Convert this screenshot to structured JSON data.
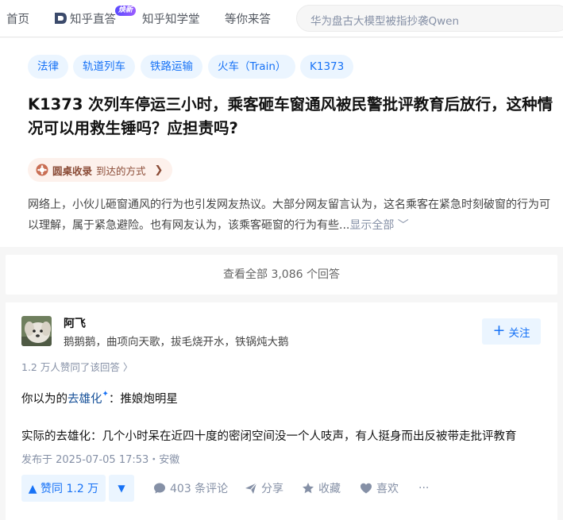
{
  "nav": {
    "home": "首页",
    "zhida": "知乎直答",
    "zhida_badge": "焕新",
    "zhixuetang": "知乎知学堂",
    "waiting": "等你来答",
    "search_placeholder": "华为盘古大模型被指抄袭Qwen"
  },
  "question": {
    "tags": [
      "法律",
      "轨道列车",
      "铁路运输",
      "火车（Train）",
      "K1373"
    ],
    "title": "K1373 次列车停运三小时，乘客砸车窗通风被民警批评教育后放行，这种情况可以用救生锤吗？应担责吗?",
    "roundtable_label": "圆桌收录",
    "roundtable_text": "到达的方式",
    "roundtable_arrow": "❯",
    "description": "网络上，小伙儿砸窗通风的行为也引发网友热议。大部分网友留言认为，这名乘客在紧急时刻破窗的行为可以理解，属于紧急避险。也有网友认为，该乘客砸窗的行为有些...",
    "show_all": "显示全部 ﹀"
  },
  "view_all": "查看全部 3,086 个回答",
  "answer": {
    "author_name": "阿飞",
    "author_bio": "鹅鹅鹅，曲项向天歌，拔毛烧开水，铁锅炖大鹅",
    "follow_label": "关注",
    "upvote_summary": "1.2 万人赞同了该回答",
    "upvote_summary_arrow": "〉",
    "line1_prefix": "你以为的",
    "line1_link": "去雄化",
    "line1_suffix": "：推娘炮明星",
    "line2": "实际的去雄化：几个小时呆在近四十度的密闭空间没一个人吱声，有人挺身而出反被带走批评教育",
    "meta": "发布于 2025-07-05 17:53・安徽",
    "vote_label": "▲ 赞同 1.2 万",
    "vote_down": "▼",
    "comments": "403 条评论",
    "share": "分享",
    "collect": "收藏",
    "like": "喜欢",
    "more": "···"
  },
  "colors": {
    "brand_blue": "#1772f6",
    "tag_bg": "#ebf5ff",
    "muted": "#8590a6",
    "pill_bg": "#fdf1ec"
  }
}
